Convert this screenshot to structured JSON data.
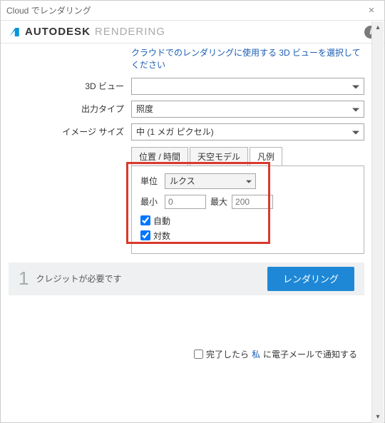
{
  "window": {
    "title": "Cloud でレンダリング"
  },
  "brand": {
    "name": "AUTODESK",
    "sub": "RENDERING"
  },
  "instruction": "クラウドでのレンダリングに使用する 3D ビューを選択してください",
  "labels": {
    "view3d": "3D ビュー",
    "output_type": "出力タイプ",
    "image_size": "イメージ サイズ"
  },
  "values": {
    "view3d": "",
    "output_type": "照度",
    "image_size": "中 (1 メガ ピクセル)"
  },
  "tabs": {
    "location_time": "位置 / 時間",
    "sky_model": "天空モデル",
    "legend": "凡例"
  },
  "legend_panel": {
    "unit_label": "単位",
    "unit_value": "ルクス",
    "min_label": "最小",
    "min_value": "0",
    "max_label": "最大",
    "max_value": "200",
    "auto_label": "自動",
    "auto_checked": true,
    "log_label": "対数",
    "log_checked": true
  },
  "footer": {
    "credits": "1",
    "credits_text": "クレジットが必要です",
    "render_button": "レンダリング"
  },
  "notify": {
    "prefix": "完了したら",
    "link": "私",
    "suffix": "に電子メールで通知する",
    "checked": false
  }
}
